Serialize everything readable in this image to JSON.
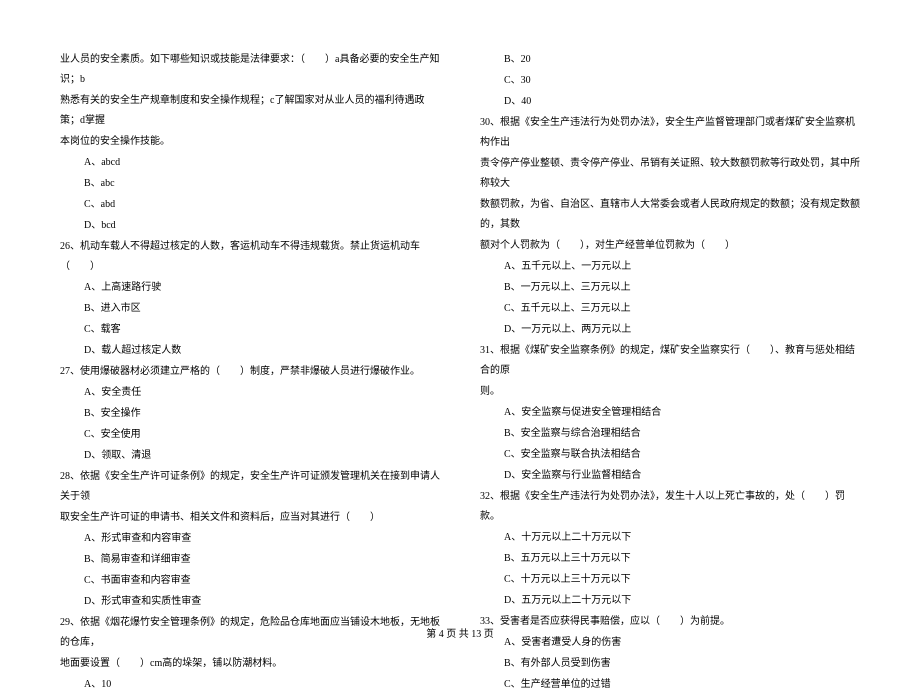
{
  "left_column": {
    "intro_lines": [
      "业人员的安全素质。如下哪些知识或技能是法律要求：（　　）a具备必要的安全生产知识；b",
      "熟悉有关的安全生产规章制度和安全操作规程；c了解国家对从业人员的福利待遇政策；d掌握",
      "本岗位的安全操作技能。"
    ],
    "q_intro_options": [
      "A、abcd",
      "B、abc",
      "C、abd",
      "D、bcd"
    ],
    "q26": {
      "text": "26、机动车载人不得超过核定的人数，客运机动车不得违规载货。禁止货运机动车（　　）",
      "options": [
        "A、上高速路行驶",
        "B、进入市区",
        "C、载客",
        "D、载人超过核定人数"
      ]
    },
    "q27": {
      "text": "27、使用爆破器材必须建立严格的（　　）制度，严禁非爆破人员进行爆破作业。",
      "options": [
        "A、安全责任",
        "B、安全操作",
        "C、安全使用",
        "D、领取、清退"
      ]
    },
    "q28": {
      "text_lines": [
        "28、依据《安全生产许可证条例》的规定，安全生产许可证颁发管理机关在接到申请人关于领",
        "取安全生产许可证的申请书、相关文件和资料后，应当对其进行（　　）"
      ],
      "options": [
        "A、形式审查和内容审查",
        "B、简易审查和详细审查",
        "C、书面审查和内容审查",
        "D、形式审查和实质性审查"
      ]
    },
    "q29": {
      "text_lines": [
        "29、依据《烟花爆竹安全管理条例》的规定，危险品仓库地面应当铺设木地板，无地板的仓库，",
        "地面要设置（　　）cm高的垛架，铺以防潮材料。"
      ],
      "options": [
        "A、10"
      ]
    }
  },
  "right_column": {
    "q29_cont_options": [
      "B、20",
      "C、30",
      "D、40"
    ],
    "q30": {
      "text_lines": [
        "30、根据《安全生产违法行为处罚办法》，安全生产监督管理部门或者煤矿安全监察机构作出",
        "责令停产停业整顿、责令停产停业、吊销有关证照、较大数额罚款等行政处罚，其中所称较大",
        "数额罚款，为省、自治区、直辖市人大常委会或者人民政府规定的数额；没有规定数额的，其数",
        "额对个人罚款为（　　），对生产经营单位罚款为（　　）"
      ],
      "options": [
        "A、五千元以上、一万元以上",
        "B、一万元以上、三万元以上",
        "C、五千元以上、三万元以上",
        "D、一万元以上、两万元以上"
      ]
    },
    "q31": {
      "text_lines": [
        "31、根据《煤矿安全监察条例》的规定，煤矿安全监察实行（　　）、教育与惩处相结合的原",
        "则。"
      ],
      "options": [
        "A、安全监察与促进安全管理相结合",
        "B、安全监察与综合治理相结合",
        "C、安全监察与联合执法相结合",
        "D、安全监察与行业监督相结合"
      ]
    },
    "q32": {
      "text": "32、根据《安全生产违法行为处罚办法》，发生十人以上死亡事故的，处（　　）罚款。",
      "options": [
        "A、十万元以上二十万元以下",
        "B、五万元以上三十万元以下",
        "C、十万元以上三十万元以下",
        "D、五万元以上二十万元以下"
      ]
    },
    "q33": {
      "text": "33、受害者是否应获得民事赔偿，应以（　　）为前提。",
      "options": [
        "A、受害者遭受人身的伤害",
        "B、有外部人员受到伤害",
        "C、生产经营单位的过错"
      ]
    }
  },
  "footer": "第 4 页 共 13 页"
}
